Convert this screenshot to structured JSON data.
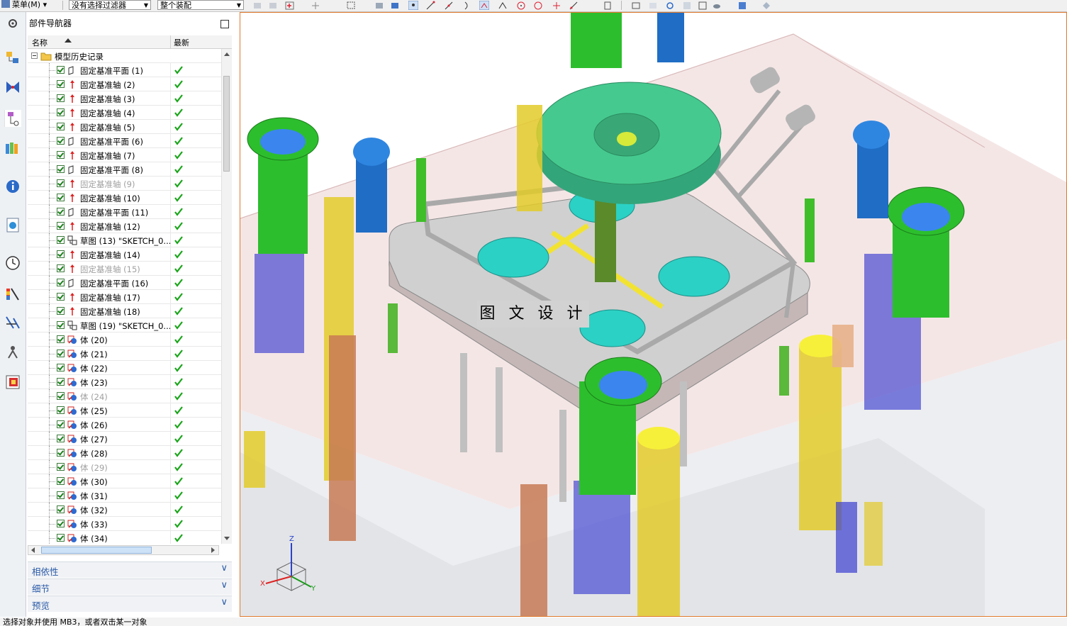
{
  "toolbar": {
    "menu_label": "菜单(M)",
    "filter_value": "没有选择过滤器",
    "assembly_value": "整个装配"
  },
  "navigator": {
    "title": "部件导航器",
    "col_name": "名称",
    "col_latest": "最新",
    "history_label": "模型历史记录",
    "rows": [
      {
        "label": "固定基准平面 (1)",
        "icon": "datum-plane-icon",
        "dim": false
      },
      {
        "label": "固定基准轴 (2)",
        "icon": "datum-axis-icon",
        "dim": false
      },
      {
        "label": "固定基准轴 (3)",
        "icon": "datum-axis-icon",
        "dim": false
      },
      {
        "label": "固定基准轴 (4)",
        "icon": "datum-axis-icon",
        "dim": false
      },
      {
        "label": "固定基准轴 (5)",
        "icon": "datum-axis-icon",
        "dim": false
      },
      {
        "label": "固定基准平面 (6)",
        "icon": "datum-plane-icon",
        "dim": false
      },
      {
        "label": "固定基准轴 (7)",
        "icon": "datum-axis-icon",
        "dim": false
      },
      {
        "label": "固定基准平面 (8)",
        "icon": "datum-plane-icon",
        "dim": false
      },
      {
        "label": "固定基准轴 (9)",
        "icon": "datum-axis-icon",
        "dim": true
      },
      {
        "label": "固定基准轴 (10)",
        "icon": "datum-axis-icon",
        "dim": false
      },
      {
        "label": "固定基准平面 (11)",
        "icon": "datum-plane-icon",
        "dim": false
      },
      {
        "label": "固定基准轴 (12)",
        "icon": "datum-axis-icon",
        "dim": false
      },
      {
        "label": "草图 (13) \"SKETCH_0...",
        "icon": "sketch-icon",
        "dim": false
      },
      {
        "label": "固定基准轴 (14)",
        "icon": "datum-axis-icon",
        "dim": false
      },
      {
        "label": "固定基准轴 (15)",
        "icon": "datum-axis-icon",
        "dim": true
      },
      {
        "label": "固定基准平面 (16)",
        "icon": "datum-plane-icon",
        "dim": false
      },
      {
        "label": "固定基准轴 (17)",
        "icon": "datum-axis-icon",
        "dim": false
      },
      {
        "label": "固定基准轴 (18)",
        "icon": "datum-axis-icon",
        "dim": false
      },
      {
        "label": "草图 (19) \"SKETCH_0...",
        "icon": "sketch-icon",
        "dim": false
      },
      {
        "label": "体 (20)",
        "icon": "body-icon",
        "dim": false
      },
      {
        "label": "体 (21)",
        "icon": "body-icon",
        "dim": false
      },
      {
        "label": "体 (22)",
        "icon": "body-icon",
        "dim": false
      },
      {
        "label": "体 (23)",
        "icon": "body-icon",
        "dim": false
      },
      {
        "label": "体 (24)",
        "icon": "body-icon",
        "dim": true
      },
      {
        "label": "体 (25)",
        "icon": "body-icon",
        "dim": false
      },
      {
        "label": "体 (26)",
        "icon": "body-icon",
        "dim": false
      },
      {
        "label": "体 (27)",
        "icon": "body-icon",
        "dim": false
      },
      {
        "label": "体 (28)",
        "icon": "body-icon",
        "dim": false
      },
      {
        "label": "体 (29)",
        "icon": "body-icon",
        "dim": true
      },
      {
        "label": "体 (30)",
        "icon": "body-icon",
        "dim": false
      },
      {
        "label": "体 (31)",
        "icon": "body-icon",
        "dim": false
      },
      {
        "label": "体 (32)",
        "icon": "body-icon",
        "dim": false
      },
      {
        "label": "体 (33)",
        "icon": "body-icon",
        "dim": false
      },
      {
        "label": "体 (34)",
        "icon": "body-icon",
        "dim": false
      }
    ],
    "panels": [
      "相依性",
      "细节",
      "预览"
    ]
  },
  "viewport": {
    "watermark": "图 文 设 计",
    "axes": {
      "x": "X",
      "y": "Y",
      "z": "Z"
    }
  },
  "status_text": "选择对象并使用 MB3，或者双击某一对象",
  "colors": {
    "accent": "#e07a2c",
    "panel_text": "#2b5aa8",
    "check_green": "#1aa51a"
  }
}
